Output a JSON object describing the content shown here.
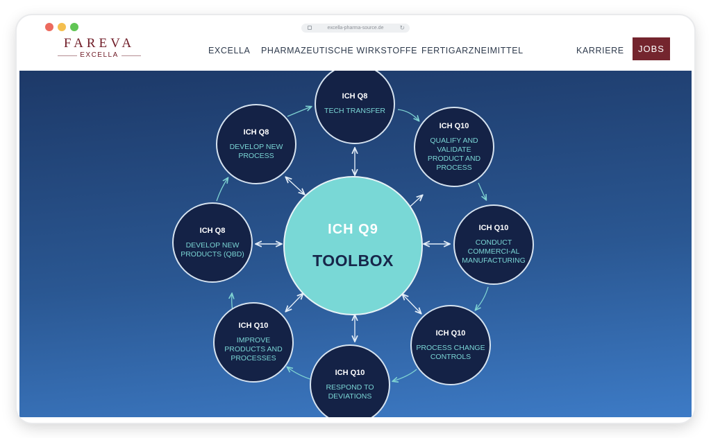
{
  "browser": {
    "url": "excella-pharma-source.de"
  },
  "header": {
    "logo_main": "FAREVA",
    "logo_sub": "EXCELLA",
    "nav": [
      "EXCELLA",
      "PHARMAZEUTISCHE WIRKSTOFFE",
      "FERTIGARZNEIMITTEL",
      "KARRIERE"
    ],
    "jobs_label": "JOBS"
  },
  "diagram": {
    "center": {
      "title": "ICH Q9",
      "subtitle": "TOOLBOX"
    },
    "nodes": [
      {
        "code": "ICH Q8",
        "label": "TECH TRANSFER"
      },
      {
        "code": "ICH Q10",
        "label": "QUALIFY AND VALIDATE PRODUCT AND PROCESS"
      },
      {
        "code": "ICH Q10",
        "label": "CONDUCT COMMERCI-AL MANUFACTURING"
      },
      {
        "code": "ICH Q10",
        "label": "PROCESS CHANGE CONTROLS"
      },
      {
        "code": "ICH Q10",
        "label": "RESPOND TO DEVIATIONS"
      },
      {
        "code": "ICH Q10",
        "label": "IMPROVE PRODUCTS AND PROCESSES"
      },
      {
        "code": "ICH Q8",
        "label": "DEVELOP NEW PRODUCTS (QBD)"
      },
      {
        "code": "ICH Q8",
        "label": "DEVELOP NEW PROCESS"
      }
    ]
  },
  "colors": {
    "brand": "#6e1a25",
    "jobs_bg": "#74252e",
    "node_bg": "#142246",
    "node_text": "#7ad5d4",
    "center_bg": "#79d8d6",
    "cycle_arrow": "#7fd3d2"
  }
}
